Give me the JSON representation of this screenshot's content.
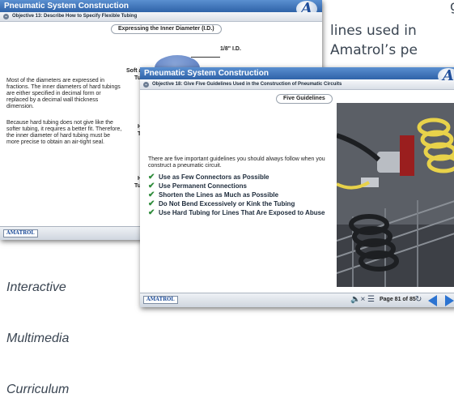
{
  "background": {
    "text_lines": [
      "lines used in",
      "Amatrol’s pe"
    ],
    "partial_top_text": "g,",
    "caption_lines": [
      "Interactive",
      "Multimedia",
      "Curriculum"
    ]
  },
  "slide_back": {
    "header_title": "Pneumatic System Construction",
    "logo_letter": "A",
    "objective": "Objective 13: Describe How to Specify Flexible Tubing",
    "section_tab": "Expressing the Inner Diameter (I.D.)",
    "paragraph1": "Most of the diameters are expressed in fractions. The inner diameters of hard tubings are either specified in decimal form or replaced by a decimal wall thickness dimension.",
    "paragraph2": "Because hard tubing does not give like the softer tubing, it requires a better fit. Therefore, the inner diameter of hard tubing must be more precise to obtain an air-tight seal.",
    "label_id": "1/8\" I.D.",
    "label_soft": "Soft a",
    "label_soft_2": "Tub",
    "label_h1": "Ha",
    "label_h1_2": "Tu",
    "label_h2": "H",
    "label_h2_2": "Tul",
    "footer_brand": "AMATROL"
  },
  "slide_front": {
    "header_title": "Pneumatic System Construction",
    "logo_letter": "A",
    "objective": "Objective 18: Give Five Guidelines Used in the Construction of Pneumatic Circuits",
    "section_tab": "Five Guidelines",
    "intro": "There are five important guidelines you should always follow when you construct a pneumatic circuit.",
    "guidelines": [
      "Use as Few Connectors as Possible",
      "Use Permanent Connections",
      "Shorten the Lines as Much as Possible",
      "Do Not Bend Excessively or Kink the Tubing",
      "Use Hard Tubing for Lines That Are Exposed to Abuse"
    ],
    "footer_brand": "AMATROL",
    "page_indicator": "Page 81 of 85",
    "icons": [
      "speaker-mute-icon",
      "menu-icon",
      "refresh-icon",
      "prev-arrow-icon",
      "next-arrow-icon"
    ],
    "colors": {
      "header": "#2f63a8",
      "check": "#2e8b3a",
      "nav_arrow": "#2b73d1"
    }
  }
}
